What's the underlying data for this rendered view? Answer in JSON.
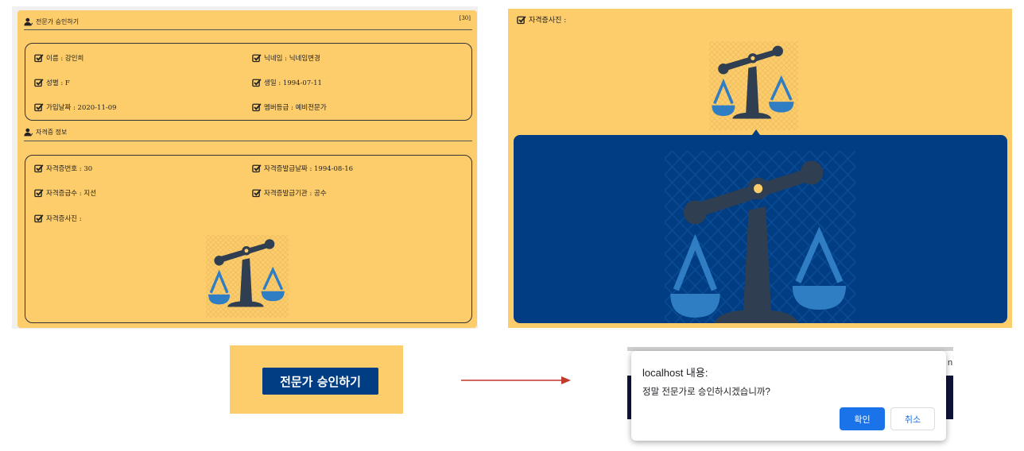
{
  "left": {
    "header_title": "전문가 승인하기",
    "count": "[30]",
    "profile": {
      "name": "이름 : 강인희",
      "nickname": "닉네임 : 닉네임변경",
      "gender": "성별 : F",
      "birth": "생일 : 1994-07-11",
      "join_date": "가입날짜 : 2020-11-09",
      "member_grade": "멤버등급 : 예비전문가"
    },
    "cert_section_title": "자격증 정보",
    "cert": {
      "number": "자격증번호 : 30",
      "issue_date": "자격증발급날짜 : 1994-08-16",
      "grade": "자격증급수 : 지선",
      "issuer": "자격증발급기관 : 공수",
      "photo_label": "자격증사진 :"
    }
  },
  "right": {
    "photo_label": "자격증사진 :"
  },
  "approve_button_label": "전문가 승인하기",
  "dialog": {
    "title": "localhost 내용:",
    "message": "정말 전문가로 승인하시겠습니까?",
    "ok_label": "확인",
    "cancel_label": "취소",
    "background_letter": "n"
  },
  "colors": {
    "panel_yellow": "#fecd6b",
    "navy": "#003d82",
    "scale_dark": "#2f3e50",
    "scale_blue": "#2f7ec4",
    "dialog_blue": "#1a73e8",
    "arrow_red": "#c0392b"
  },
  "icons": [
    "person-icon",
    "checkbox-icon",
    "scale-icon",
    "arrow-icon"
  ]
}
